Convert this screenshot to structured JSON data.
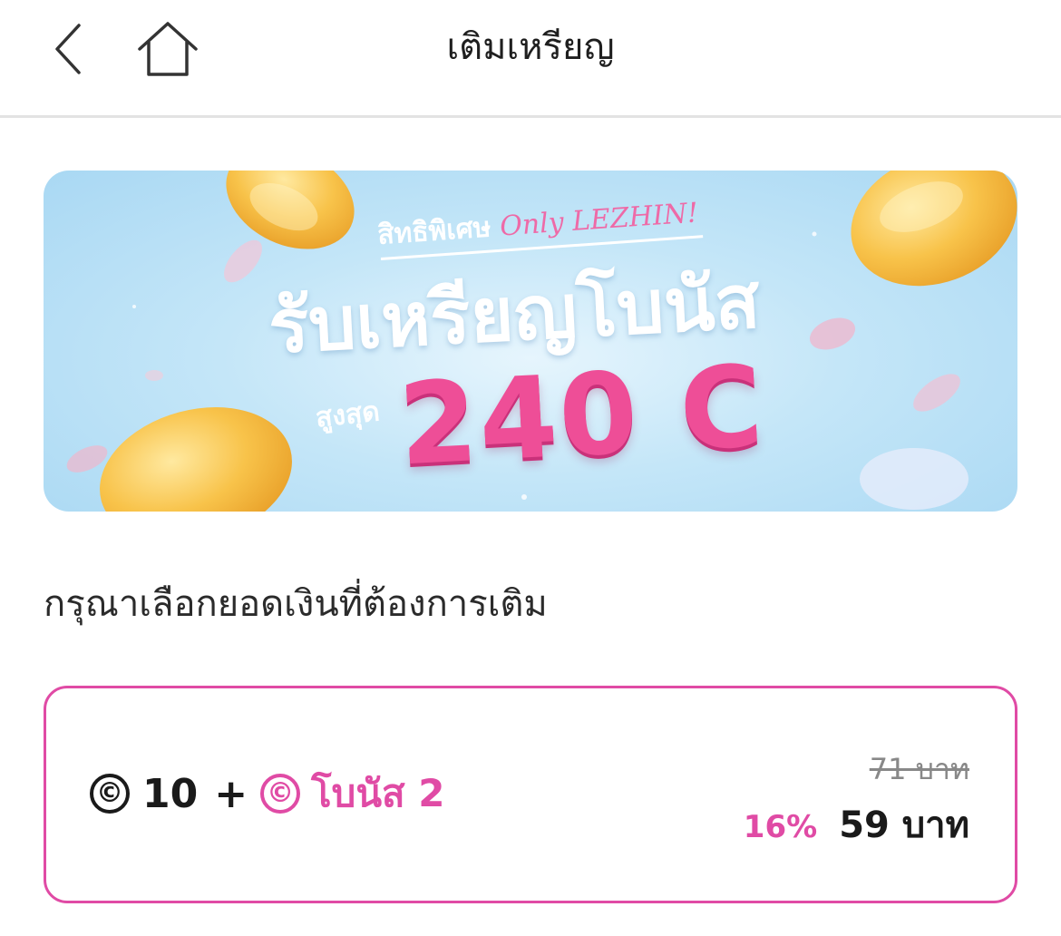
{
  "header": {
    "title": "เติมเหรียญ",
    "back_icon": "chevron-left-icon",
    "home_icon": "home-icon"
  },
  "banner": {
    "subtitle": "สิทธิพิเศษ",
    "brand_tag": "Only LEZHIN!",
    "headline": "รับเหรียญโบนัส",
    "max_label": "สูงสุด",
    "amount": "240 C",
    "colors": {
      "background": "#b9e1f6",
      "accent": "#ee4e97",
      "coin": "#f8c34a"
    }
  },
  "prompt": "กรุณาเลือกยอดเงินที่ต้องการเติม",
  "options": [
    {
      "coin_symbol": "©",
      "coins": "10",
      "plus": "+",
      "bonus_symbol": "©",
      "bonus_label": "โบนัส 2",
      "original_price": "71 บาท",
      "discount": "16%",
      "price": "59 บาท",
      "selected": true
    }
  ],
  "colors": {
    "accent": "#e04ba5",
    "divider": "#e3e3e3",
    "text": "#1a1a1a"
  }
}
